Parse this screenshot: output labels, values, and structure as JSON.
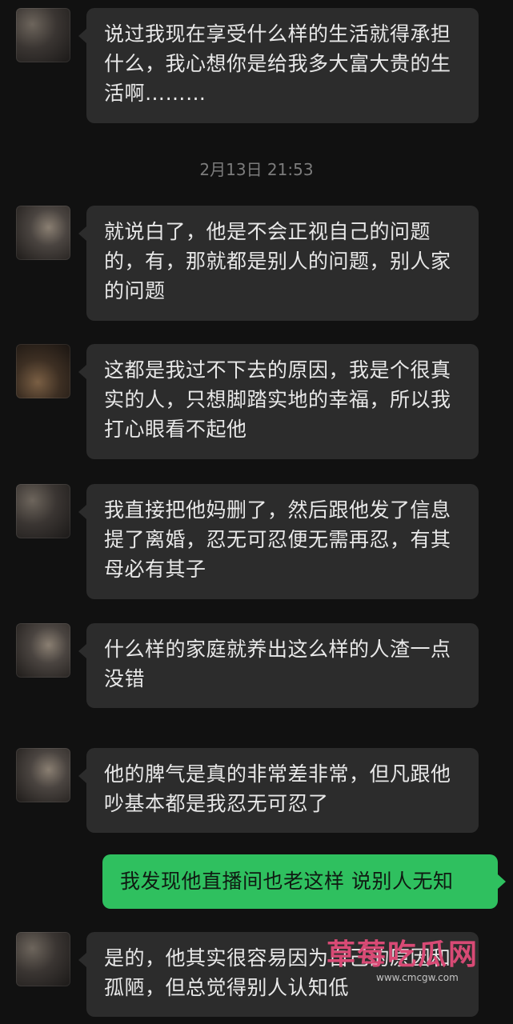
{
  "timestamp": "2月13日 21:53",
  "messages": [
    {
      "text": "说过我现在享受什么样的生活就得承担什么，我心想你是给我多大富大贵的生活啊………"
    },
    {
      "text": "就说白了，他是不会正视自己的问题的，有，那就都是别人的问题，别人家的问题"
    },
    {
      "text": "这都是我过不下去的原因，我是个很真实的人，只想脚踏实地的幸福，所以我打心眼看不起他"
    },
    {
      "text": "我直接把他妈删了，然后跟他发了信息提了离婚，忍无可忍便无需再忍，有其母必有其子"
    },
    {
      "text": "什么样的家庭就养出这么样的人渣一点没错"
    },
    {
      "text": "他的脾气是真的非常差非常，但凡跟他吵基本都是我忍无可忍了"
    },
    {
      "text": "是的，他其实很容易因为自己的原因和孤陋，但总觉得别人认知低"
    }
  ],
  "my_message": "我发现他直播间也老这样 说别人无知",
  "watermark": {
    "title": "草莓吃瓜网",
    "url": "www.cmcgw.com"
  }
}
